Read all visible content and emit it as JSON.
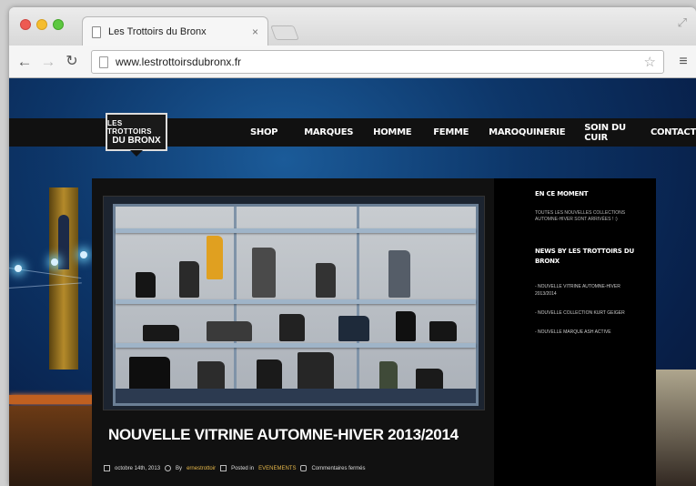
{
  "browser": {
    "tab_title": "Les Trottoirs du Bronx",
    "tab_close": "×",
    "url": "www.lestrottoirsdubronx.fr",
    "icons": [
      "back-icon",
      "forward-icon",
      "reload-icon",
      "star-icon",
      "menu-icon",
      "fullscreen-icon"
    ]
  },
  "site": {
    "logo_line1": "LES TROTTOIRS",
    "logo_line2": "DU BRONX",
    "nav": [
      "SHOP",
      "MARQUES",
      "HOMME",
      "FEMME",
      "MAROQUINERIE",
      "SOIN DU CUIR",
      "CONTACT"
    ]
  },
  "article": {
    "title": "NOUVELLE VITRINE AUTOMNE-HIVER 2013/2014",
    "date": "octobre 14th, 2013",
    "by_label": "By",
    "author": "ernestrottoir",
    "posted_label": "Posted in",
    "category": "EVENEMENTS",
    "comments": "Commentaires fermés"
  },
  "sidebar": {
    "widget1_title": "EN CE MOMENT",
    "widget1_text": "TOUTES LES NOUVELLES COLLECTIONS AUTOMNE-HIVER SONT ARRIVÉES ! :)",
    "widget2_title": "NEWS BY LES TROTTOIRS DU BRONX",
    "news": [
      "NOUVELLE VITRINE AUTOMNE-HIVER 2013/2014",
      "NOUVELLE COLLECTION KURT GEIGER",
      "NOUVELLE MARQUE ASH ACTIVE"
    ]
  },
  "colors": {
    "header_bg": "#111111",
    "sidebar_bg": "#000000",
    "accent": "#e6b84a",
    "sky": "#0d3669"
  }
}
